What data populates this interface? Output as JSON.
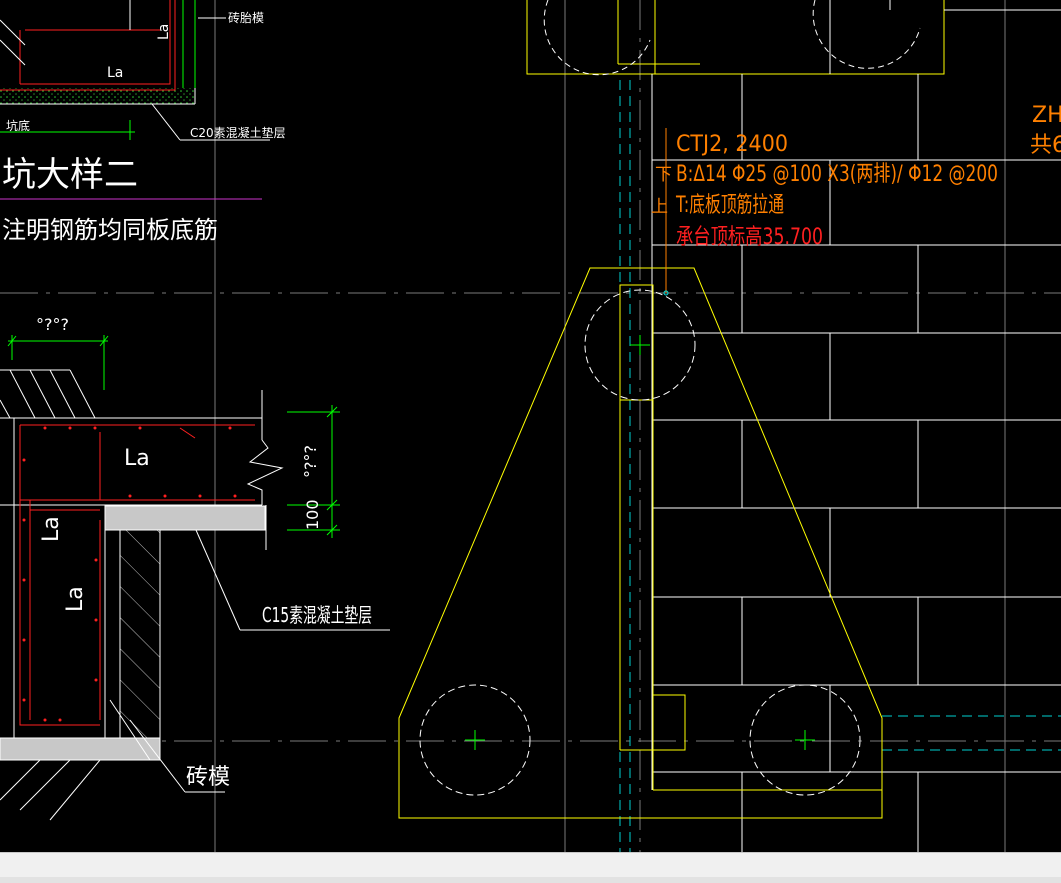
{
  "labels": {
    "top_formwork": "砖胎模",
    "la": "La",
    "pit_label": "坑底",
    "c20_cushion": "C20素混凝土垫层",
    "title": "坑大样二",
    "note": "注明钢筋均同板底筋",
    "dim_top": "°?°?",
    "dim_right": "°?°?",
    "dim_100": "100",
    "c15_cushion": "C15素混凝土垫层",
    "brick_formwork": "砖模",
    "ctj_name": "CTJ2, 2400",
    "ctj_bottom": "B:Δ14 Φ25 @100 X3(两排)/ Φ12 @200",
    "ctj_top": "T:底板顶筋拉通",
    "ctj_elev": "承台顶标高35.700",
    "mark_b": "下",
    "mark_t": "上",
    "edge_top": "ZH",
    "edge_bottom": "共6"
  },
  "colors": {
    "background": "#000000",
    "white": "#ffffff",
    "yellow": "#ffff00",
    "red": "#ff2020",
    "orange": "#ff8000",
    "green": "#00ff00",
    "cyan": "#00e0e0",
    "magenta": "#cc33cc",
    "gray": "#808080",
    "statusbar": "#f0f0f0"
  }
}
